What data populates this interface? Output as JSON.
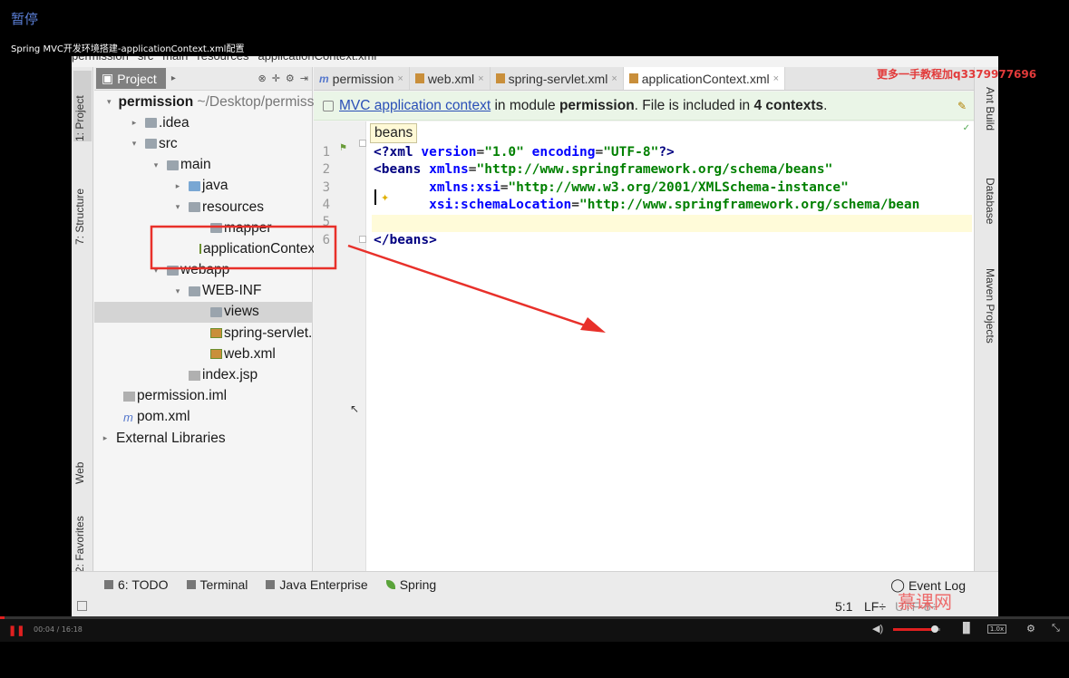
{
  "player": {
    "pause_label": "暂停",
    "video_title": "Spring MVC开发环境搭建-applicationContext.xml配置",
    "current_time": "00:04",
    "duration": "16:18",
    "time_sep": " / ",
    "progress_fraction": 0.004,
    "volume_fraction": 0.88,
    "speed_label": "1.0x",
    "watermark": "更多一手教程加q3379977696",
    "logo_text": "慕课网"
  },
  "ide": {
    "breadcrumb": [
      "permission",
      "src",
      "main",
      "resources",
      "applicationContext.xml"
    ],
    "left_tabs": [
      "1: Project",
      "7: Structure",
      "Web",
      "2: Favorites"
    ],
    "right_tabs": [
      "Ant Build",
      "Database",
      "Maven Projects"
    ],
    "project_panel": {
      "tab_label": "Project",
      "rows": [
        {
          "label": "permission",
          "suffix": " ~/Desktop/permiss",
          "indent": 0,
          "arrow": "▾",
          "icon": "folder",
          "bold": true
        },
        {
          "label": ".idea",
          "indent": 1,
          "arrow": "▸",
          "icon": "folder"
        },
        {
          "label": "src",
          "indent": 1,
          "arrow": "▾",
          "icon": "folder"
        },
        {
          "label": "main",
          "indent": 2,
          "arrow": "▾",
          "icon": "folder"
        },
        {
          "label": "java",
          "indent": 3,
          "arrow": "▸",
          "icon": "folder-blue"
        },
        {
          "label": "resources",
          "indent": 3,
          "arrow": "▾",
          "icon": "folder"
        },
        {
          "label": "mapper",
          "indent": 4,
          "arrow": "",
          "icon": "folder"
        },
        {
          "label": "applicationContex",
          "indent": 4,
          "arrow": "",
          "icon": "xml"
        },
        {
          "label": "webapp",
          "indent": 2,
          "arrow": "▾",
          "icon": "folder"
        },
        {
          "label": "WEB-INF",
          "indent": 3,
          "arrow": "▾",
          "icon": "folder"
        },
        {
          "label": "views",
          "indent": 4,
          "arrow": "",
          "icon": "folder",
          "selected": true
        },
        {
          "label": "spring-servlet.",
          "indent": 4,
          "arrow": "",
          "icon": "xml"
        },
        {
          "label": "web.xml",
          "indent": 4,
          "arrow": "",
          "icon": "xml"
        },
        {
          "label": "index.jsp",
          "indent": 3,
          "arrow": "",
          "icon": "file"
        },
        {
          "label": "permission.iml",
          "indent": 0,
          "arrow": "",
          "icon": "file"
        },
        {
          "label": "pom.xml",
          "indent": 0,
          "arrow": "",
          "icon": "maven"
        },
        {
          "label": "External Libraries",
          "indent": -1,
          "arrow": "▸",
          "icon": "none"
        }
      ]
    },
    "editor_tabs": [
      {
        "label": "permission",
        "icon": "m",
        "active": false
      },
      {
        "label": "web.xml",
        "icon": "xml",
        "active": false
      },
      {
        "label": "spring-servlet.xml",
        "icon": "xml",
        "active": false
      },
      {
        "label": "applicationContext.xml",
        "icon": "xml",
        "active": true
      }
    ],
    "banner": {
      "link": "MVC application context",
      "text1": " in module ",
      "module": "permission",
      "text2": ". File is included in ",
      "count": "4 contexts",
      "text3": "."
    },
    "tooltip": "beans",
    "line_numbers": [
      "1",
      "2",
      "3",
      "4",
      "5",
      "6"
    ],
    "code_lines": [
      [
        {
          "t": "<?",
          "c": "k"
        },
        {
          "t": "xml ",
          "c": "k"
        },
        {
          "t": "version",
          "c": "a"
        },
        {
          "t": "=",
          "c": ""
        },
        {
          "t": "\"1.0\"",
          "c": "v"
        },
        {
          "t": " ",
          "c": ""
        },
        {
          "t": "encoding",
          "c": "a"
        },
        {
          "t": "=",
          "c": ""
        },
        {
          "t": "\"UTF-8\"",
          "c": "v"
        },
        {
          "t": "?>",
          "c": "k"
        }
      ],
      [
        {
          "t": "<beans ",
          "c": "k"
        },
        {
          "t": "xmlns",
          "c": "a"
        },
        {
          "t": "=",
          "c": ""
        },
        {
          "t": "\"http://www.springframework.org/schema/beans\"",
          "c": "v"
        }
      ],
      [
        {
          "t": "       ",
          "c": ""
        },
        {
          "t": "xmlns:xsi",
          "c": "a"
        },
        {
          "t": "=",
          "c": ""
        },
        {
          "t": "\"http://www.w3.org/2001/XMLSchema-instance\"",
          "c": "v"
        }
      ],
      [
        {
          "t": "       ",
          "c": ""
        },
        {
          "t": "xsi:schemaLocation",
          "c": "a"
        },
        {
          "t": "=",
          "c": ""
        },
        {
          "t": "\"http://www.springframework.org/schema/bean",
          "c": "v"
        }
      ],
      [],
      [
        {
          "t": "</beans>",
          "c": "k"
        }
      ]
    ],
    "bottom_tools": [
      {
        "label": "6: TODO",
        "icon": "todo"
      },
      {
        "label": "Terminal",
        "icon": "terminal"
      },
      {
        "label": "Java Enterprise",
        "icon": "java-ee"
      },
      {
        "label": "Spring",
        "icon": "spring"
      }
    ],
    "event_log": "Event Log",
    "status": {
      "position": "5:1",
      "line_sep": "LF÷",
      "encoding": "UTF-8÷"
    }
  },
  "colors": {
    "accent_red": "#e8302a",
    "link_blue": "#2a4fb7",
    "banner_green": "#eaf5e7"
  }
}
